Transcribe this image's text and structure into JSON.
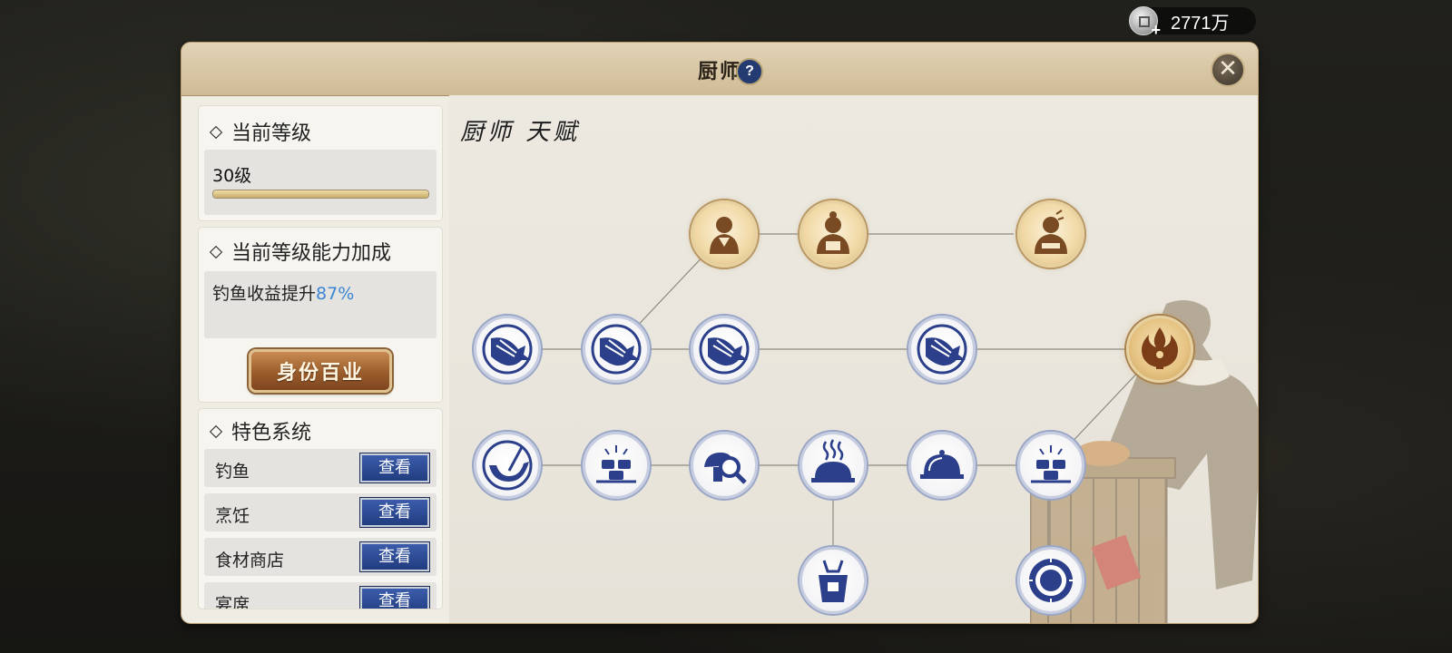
{
  "currency": {
    "icon": "silver-coin-icon",
    "add_icon": "plus-icon",
    "amount": "2771万"
  },
  "window": {
    "title": "厨师",
    "help_icon": "question-icon",
    "close_icon": "close-icon"
  },
  "level_card": {
    "title": "当前等级",
    "level_text": "30级",
    "progress": 1.0
  },
  "bonus_card": {
    "title": "当前等级能力加成",
    "bonus_label": "钓鱼收益提升",
    "bonus_value": "87%"
  },
  "identity_button": {
    "label": "身份百业"
  },
  "systems_card": {
    "title": "特色系统",
    "items": [
      {
        "label": "钓鱼",
        "button": "查看"
      },
      {
        "label": "烹饪",
        "button": "查看"
      },
      {
        "label": "食材商店",
        "button": "查看"
      },
      {
        "label": "宴席",
        "button": "查看"
      }
    ]
  },
  "talent": {
    "title": "厨师 天赋",
    "nodes": [
      {
        "id": "chef-rank-1",
        "icon": "chef-apprentice-icon",
        "style": "gold"
      },
      {
        "id": "chef-rank-2",
        "icon": "chef-cook-icon",
        "style": "gold"
      },
      {
        "id": "chef-rank-3",
        "icon": "chef-master-icon",
        "style": "gold"
      },
      {
        "id": "fish-1",
        "icon": "fish-icon",
        "style": "blue"
      },
      {
        "id": "fish-2",
        "icon": "fish-icon",
        "style": "blue"
      },
      {
        "id": "fish-3",
        "icon": "fish-icon",
        "style": "blue"
      },
      {
        "id": "fish-4",
        "icon": "fish-icon",
        "style": "blue"
      },
      {
        "id": "flame",
        "icon": "flame-emblem-icon",
        "style": "gold"
      },
      {
        "id": "fishing-hook",
        "icon": "fishing-hook-icon",
        "style": "blue"
      },
      {
        "id": "dumplings-1",
        "icon": "dumplings-icon",
        "style": "blue"
      },
      {
        "id": "ingredient-search",
        "icon": "mushroom-search-icon",
        "style": "blue"
      },
      {
        "id": "steaming-dish",
        "icon": "steaming-cloche-icon",
        "style": "blue"
      },
      {
        "id": "serving-dish",
        "icon": "cloche-icon",
        "style": "blue"
      },
      {
        "id": "dumplings-2",
        "icon": "dumplings-icon",
        "style": "blue"
      },
      {
        "id": "apron",
        "icon": "apron-icon",
        "style": "blue"
      },
      {
        "id": "plate",
        "icon": "plate-icon",
        "style": "blue"
      }
    ]
  },
  "colors": {
    "accent_blue": "#3a86d6",
    "node_blue": "#2b3f8a",
    "node_gold": "#7a4b22",
    "button_brown": "#9a5c2b"
  }
}
